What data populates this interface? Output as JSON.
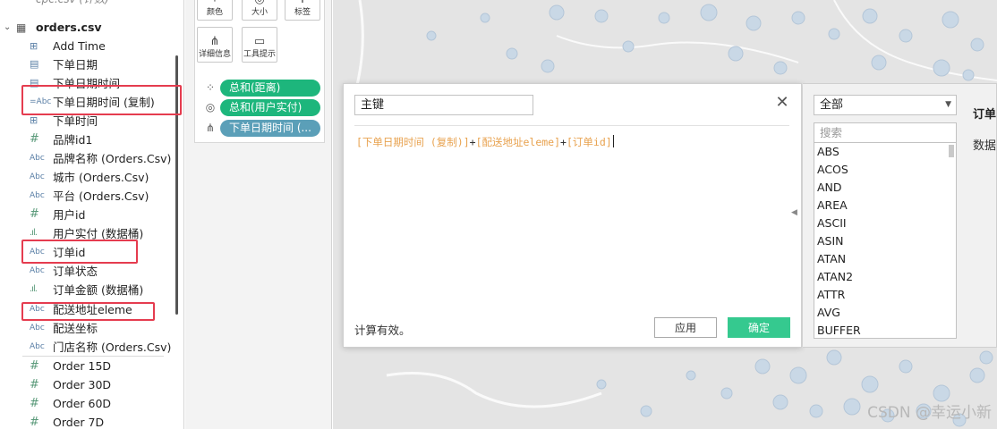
{
  "data_pane": {
    "previous_source": "cpc.csv (计数)",
    "source_name": "orders.csv",
    "fields": [
      {
        "label": "Add Time",
        "icon": "date-time-icon",
        "glyph": "⊞"
      },
      {
        "label": "下单日期",
        "icon": "date-icon",
        "glyph": "▤"
      },
      {
        "label": "下单日期时间",
        "icon": "date-icon",
        "glyph": "▤"
      },
      {
        "label": "下单日期时间 (复制)",
        "icon": "string-abc-icon",
        "glyph": "=Abc"
      },
      {
        "label": "下单时间",
        "icon": "date-time-icon",
        "glyph": "⊞"
      },
      {
        "label": "品牌id1",
        "icon": "number-icon",
        "glyph": "#"
      },
      {
        "label": "品牌名称 (Orders.Csv)",
        "icon": "string-abc-icon",
        "glyph": "Abc"
      },
      {
        "label": "城市 (Orders.Csv)",
        "icon": "string-abc-icon",
        "glyph": "Abc"
      },
      {
        "label": "平台 (Orders.Csv)",
        "icon": "string-abc-icon",
        "glyph": "Abc"
      },
      {
        "label": "用户id",
        "icon": "number-icon",
        "glyph": "#"
      },
      {
        "label": "用户实付 (数据桶)",
        "icon": "bin-icon",
        "glyph": ".ıl."
      },
      {
        "label": "订单id",
        "icon": "string-abc-icon",
        "glyph": "Abc"
      },
      {
        "label": "订单状态",
        "icon": "string-abc-icon",
        "glyph": "Abc"
      },
      {
        "label": "订单金额 (数据桶)",
        "icon": "bin-icon",
        "glyph": ".ıl."
      },
      {
        "label": "配送地址eleme",
        "icon": "string-abc-icon",
        "glyph": "Abc"
      },
      {
        "label": "配送坐标",
        "icon": "string-abc-icon",
        "glyph": "Abc"
      },
      {
        "label": "门店名称 (Orders.Csv)",
        "icon": "string-abc-icon",
        "glyph": "Abc"
      },
      {
        "label": "Order 15D",
        "icon": "number-icon",
        "glyph": "#"
      },
      {
        "label": "Order 30D",
        "icon": "number-icon",
        "glyph": "#"
      },
      {
        "label": "Order 60D",
        "icon": "number-icon",
        "glyph": "#"
      },
      {
        "label": "Order 7D",
        "icon": "number-icon",
        "glyph": "#"
      }
    ]
  },
  "marks": {
    "buttons": [
      {
        "label": "颜色",
        "icon": "color-dots-icon",
        "glyph": "⁘"
      },
      {
        "label": "大小",
        "icon": "size-icon",
        "glyph": "◎"
      },
      {
        "label": "标签",
        "icon": "label-icon",
        "glyph": "T"
      },
      {
        "label": "详细信息",
        "icon": "detail-icon",
        "glyph": "⋔"
      },
      {
        "label": "工具提示",
        "icon": "tooltip-icon",
        "glyph": "▭"
      }
    ],
    "pills": [
      {
        "label": "总和(距离)",
        "icon": "color-dots-icon",
        "glyph": "⁘",
        "color": "#1db67c"
      },
      {
        "label": "总和(用户实付)",
        "icon": "size-icon",
        "glyph": "◎",
        "color": "#1db67c"
      },
      {
        "label": "下单日期时间 (...",
        "icon": "detail-icon",
        "glyph": "⋔",
        "color": "#5b9fb8"
      }
    ]
  },
  "calc": {
    "name": "主键",
    "formula_tokens": [
      {
        "text": "[下单日期时间 (复制)]",
        "kind": "field"
      },
      {
        "text": "+",
        "kind": "op"
      },
      {
        "text": "[配送地址eleme]",
        "kind": "field"
      },
      {
        "text": "+",
        "kind": "op"
      },
      {
        "text": "[订单id]",
        "kind": "field"
      }
    ],
    "status": "计算有效。",
    "apply_label": "应用",
    "ok_label": "确定"
  },
  "functions": {
    "category": "全部",
    "search_placeholder": "搜索",
    "items": [
      "ABS",
      "ACOS",
      "AND",
      "AREA",
      "ASCII",
      "ASIN",
      "ATAN",
      "ATAN2",
      "ATTR",
      "AVG",
      "BUFFER"
    ],
    "help_title": "订单",
    "help_text": "数据"
  },
  "watermark": "CSDN @幸运小新",
  "colors": {
    "accent_green": "#35c98f",
    "highlight_red": "#e53c4f",
    "formula_field": "#e8a24f"
  }
}
